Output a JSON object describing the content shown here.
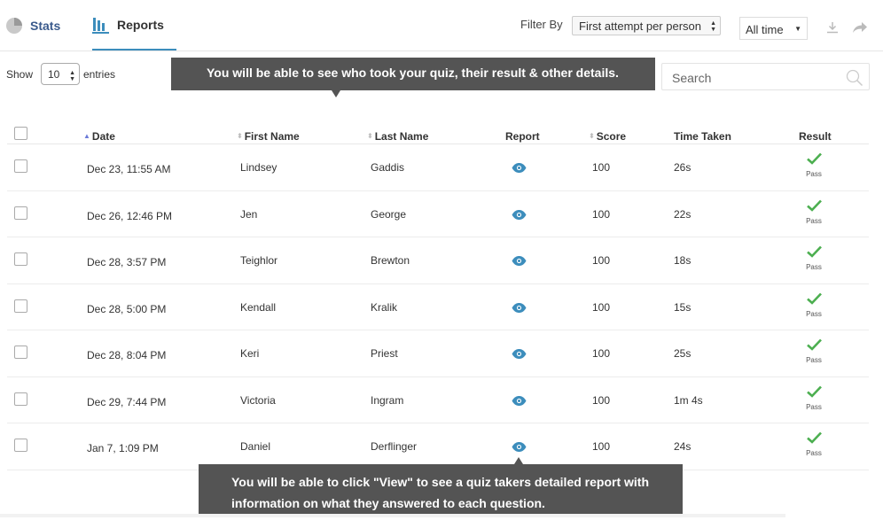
{
  "tabs": {
    "stats_label": "Stats",
    "reports_label": "Reports"
  },
  "filter": {
    "label": "Filter By",
    "selected": "First attempt per person",
    "time_selected": "All time"
  },
  "entries": {
    "show_label": "Show",
    "count": "10",
    "suffix": "entries"
  },
  "search": {
    "placeholder": "Search"
  },
  "tooltips": {
    "top": "You will be able to see who took your quiz, their result & other details.",
    "bottom_line1": "You will be able to click \"View\" to see a quiz takers detailed report with",
    "bottom_line2": "information on what they answered to each question."
  },
  "table": {
    "headers": {
      "date": "Date",
      "first_name": "First Name",
      "last_name": "Last Name",
      "report": "Report",
      "score": "Score",
      "time_taken": "Time Taken",
      "result": "Result"
    },
    "rows": [
      {
        "date": "Dec 23, 11:55 AM",
        "first": "Lindsey",
        "last": "Gaddis",
        "score": "100",
        "time": "26s",
        "result": "Pass"
      },
      {
        "date": "Dec 26, 12:46 PM",
        "first": "Jen",
        "last": "George",
        "score": "100",
        "time": "22s",
        "result": "Pass"
      },
      {
        "date": "Dec 28, 3:57 PM",
        "first": "Teighlor",
        "last": "Brewton",
        "score": "100",
        "time": "18s",
        "result": "Pass"
      },
      {
        "date": "Dec 28, 5:00 PM",
        "first": "Kendall",
        "last": "Kralik",
        "score": "100",
        "time": "15s",
        "result": "Pass"
      },
      {
        "date": "Dec 28, 8:04 PM",
        "first": "Keri",
        "last": "Priest",
        "score": "100",
        "time": "25s",
        "result": "Pass"
      },
      {
        "date": "Dec 29, 7:44 PM",
        "first": "Victoria",
        "last": "Ingram",
        "score": "100",
        "time": "1m 4s",
        "result": "Pass"
      },
      {
        "date": "Jan 7, 1:09 PM",
        "first": "Daniel",
        "last": "Derflinger",
        "score": "100",
        "time": "24s",
        "result": "Pass"
      }
    ]
  },
  "colors": {
    "accent": "#3c8dbc",
    "pass": "#4caf50",
    "tooltip_bg": "#545454"
  }
}
